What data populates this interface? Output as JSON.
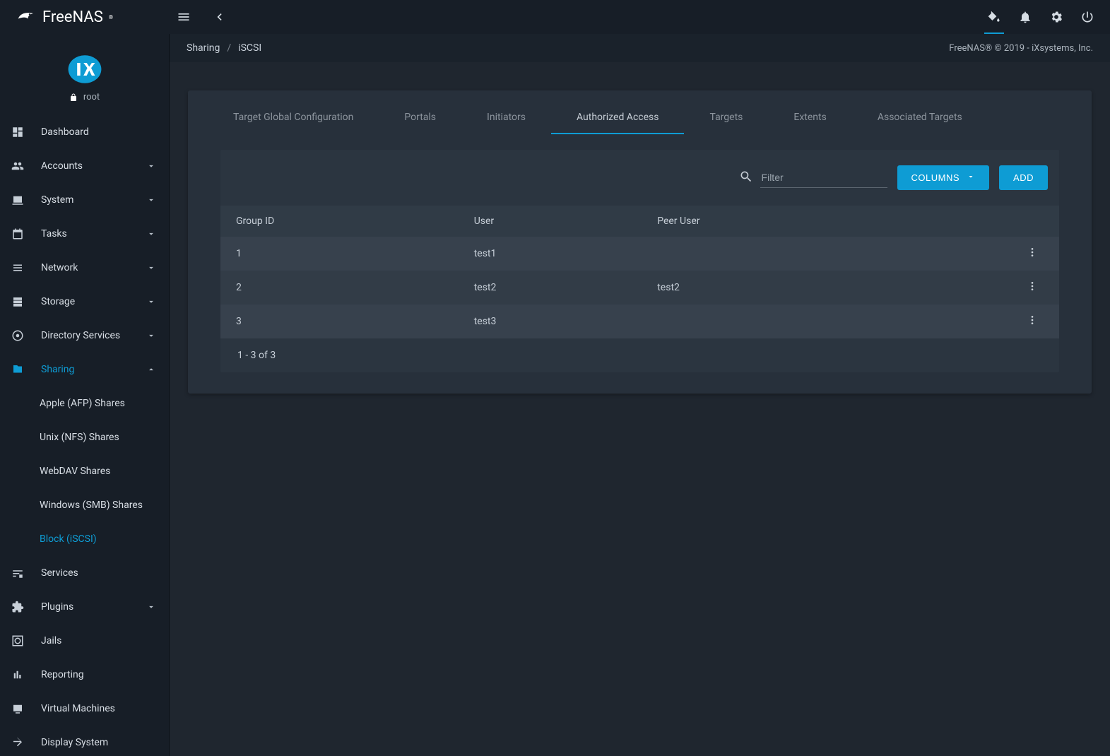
{
  "brand": "FreeNAS",
  "user": "root",
  "topbar": {
    "menu_icon": "menu",
    "collapse_icon": "chevron-left"
  },
  "breadcrumb": {
    "parent": "Sharing",
    "current": "iSCSI"
  },
  "copyright": "FreeNAS® © 2019 - iXsystems, Inc.",
  "sidebar": {
    "items": [
      {
        "label": "Dashboard",
        "expandable": false
      },
      {
        "label": "Accounts",
        "expandable": true
      },
      {
        "label": "System",
        "expandable": true
      },
      {
        "label": "Tasks",
        "expandable": true
      },
      {
        "label": "Network",
        "expandable": true
      },
      {
        "label": "Storage",
        "expandable": true
      },
      {
        "label": "Directory Services",
        "expandable": true
      },
      {
        "label": "Sharing",
        "expandable": true,
        "active": true,
        "expanded": true,
        "children": [
          {
            "label": "Apple (AFP) Shares"
          },
          {
            "label": "Unix (NFS) Shares"
          },
          {
            "label": "WebDAV Shares"
          },
          {
            "label": "Windows (SMB) Shares"
          },
          {
            "label": "Block (iSCSI)",
            "active": true
          }
        ]
      },
      {
        "label": "Services",
        "expandable": false
      },
      {
        "label": "Plugins",
        "expandable": true
      },
      {
        "label": "Jails",
        "expandable": false
      },
      {
        "label": "Reporting",
        "expandable": false
      },
      {
        "label": "Virtual Machines",
        "expandable": false
      },
      {
        "label": "Display System",
        "expandable": false
      }
    ]
  },
  "tabs": [
    {
      "label": "Target Global Configuration"
    },
    {
      "label": "Portals"
    },
    {
      "label": "Initiators"
    },
    {
      "label": "Authorized Access",
      "active": true
    },
    {
      "label": "Targets"
    },
    {
      "label": "Extents"
    },
    {
      "label": "Associated Targets"
    }
  ],
  "toolbar": {
    "filter_placeholder": "Filter",
    "columns_label": "COLUMNS",
    "add_label": "ADD"
  },
  "table": {
    "columns": [
      "Group ID",
      "User",
      "Peer User",
      ""
    ],
    "rows": [
      {
        "group_id": "1",
        "user": "test1",
        "peer_user": ""
      },
      {
        "group_id": "2",
        "user": "test2",
        "peer_user": "test2"
      },
      {
        "group_id": "3",
        "user": "test3",
        "peer_user": ""
      }
    ],
    "footer": "1 - 3 of 3"
  }
}
